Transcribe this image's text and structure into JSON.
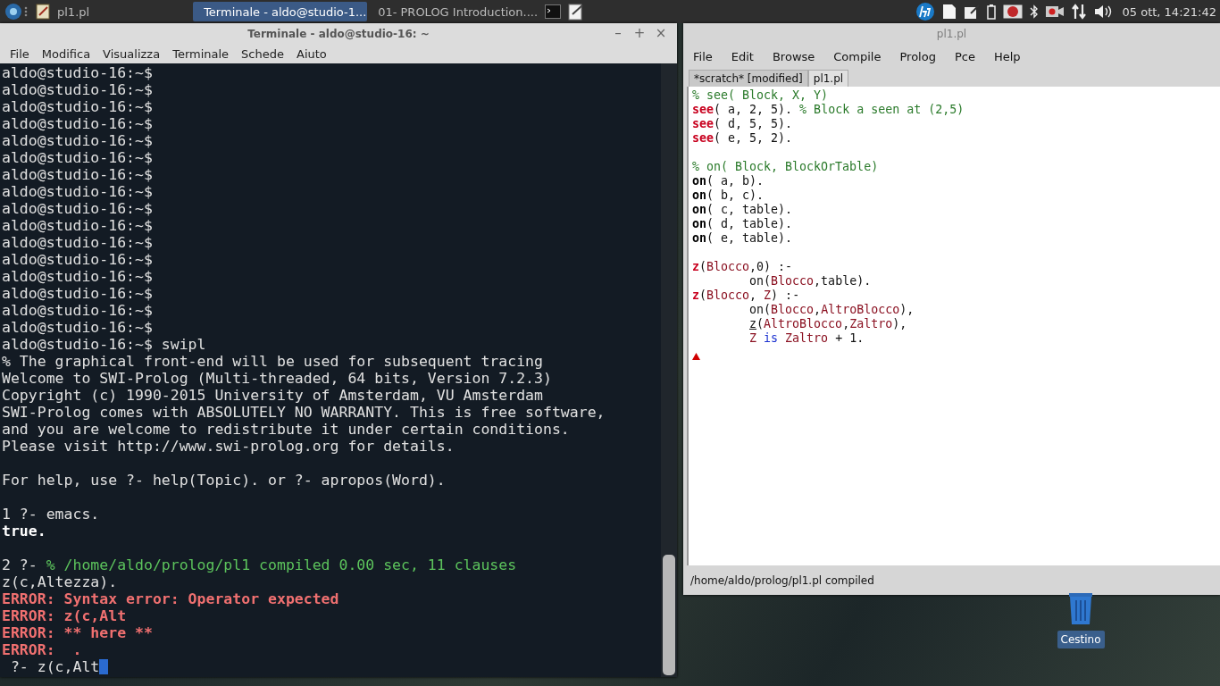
{
  "taskbar": {
    "tasks": [
      {
        "label": "pl1.pl",
        "kind": "editor",
        "selected": false
      },
      {
        "label": "Terminale - aldo@studio-1...",
        "kind": "terminal",
        "selected": true
      },
      {
        "label": "01- PROLOG Introduction....",
        "kind": "document",
        "selected": false
      }
    ],
    "clock": "05 ott, 14:21:42"
  },
  "terminal_window": {
    "title": "Terminale - aldo@studio-16: ~",
    "controls": [
      "–",
      "+",
      "×"
    ],
    "menu": [
      "File",
      "Modifica",
      "Visualizza",
      "Terminale",
      "Schede",
      "Aiuto"
    ],
    "lines": [
      {
        "kind": "text",
        "segments": [
          {
            "kind": "plain",
            "text": "aldo@studio-16:~$"
          }
        ]
      },
      {
        "kind": "text",
        "segments": [
          {
            "kind": "plain",
            "text": "aldo@studio-16:~$"
          }
        ]
      },
      {
        "kind": "text",
        "segments": [
          {
            "kind": "plain",
            "text": "aldo@studio-16:~$"
          }
        ]
      },
      {
        "kind": "text",
        "segments": [
          {
            "kind": "plain",
            "text": "aldo@studio-16:~$"
          }
        ]
      },
      {
        "kind": "text",
        "segments": [
          {
            "kind": "plain",
            "text": "aldo@studio-16:~$"
          }
        ]
      },
      {
        "kind": "text",
        "segments": [
          {
            "kind": "plain",
            "text": "aldo@studio-16:~$"
          }
        ]
      },
      {
        "kind": "text",
        "segments": [
          {
            "kind": "plain",
            "text": "aldo@studio-16:~$"
          }
        ]
      },
      {
        "kind": "text",
        "segments": [
          {
            "kind": "plain",
            "text": "aldo@studio-16:~$"
          }
        ]
      },
      {
        "kind": "text",
        "segments": [
          {
            "kind": "plain",
            "text": "aldo@studio-16:~$"
          }
        ]
      },
      {
        "kind": "text",
        "segments": [
          {
            "kind": "plain",
            "text": "aldo@studio-16:~$"
          }
        ]
      },
      {
        "kind": "text",
        "segments": [
          {
            "kind": "plain",
            "text": "aldo@studio-16:~$"
          }
        ]
      },
      {
        "kind": "text",
        "segments": [
          {
            "kind": "plain",
            "text": "aldo@studio-16:~$"
          }
        ]
      },
      {
        "kind": "text",
        "segments": [
          {
            "kind": "plain",
            "text": "aldo@studio-16:~$"
          }
        ]
      },
      {
        "kind": "text",
        "segments": [
          {
            "kind": "plain",
            "text": "aldo@studio-16:~$"
          }
        ]
      },
      {
        "kind": "text",
        "segments": [
          {
            "kind": "plain",
            "text": "aldo@studio-16:~$"
          }
        ]
      },
      {
        "kind": "text",
        "segments": [
          {
            "kind": "plain",
            "text": "aldo@studio-16:~$"
          }
        ]
      },
      {
        "kind": "text",
        "segments": [
          {
            "kind": "plain",
            "text": "aldo@studio-16:~$ swipl"
          }
        ]
      },
      {
        "kind": "text",
        "segments": [
          {
            "kind": "plain",
            "text": "% The graphical front-end will be used for subsequent tracing"
          }
        ]
      },
      {
        "kind": "text",
        "segments": [
          {
            "kind": "plain",
            "text": "Welcome to SWI-Prolog (Multi-threaded, 64 bits, Version 7.2.3)"
          }
        ]
      },
      {
        "kind": "text",
        "segments": [
          {
            "kind": "plain",
            "text": "Copyright (c) 1990-2015 University of Amsterdam, VU Amsterdam"
          }
        ]
      },
      {
        "kind": "text",
        "segments": [
          {
            "kind": "plain",
            "text": "SWI-Prolog comes with ABSOLUTELY NO WARRANTY. This is free software,"
          }
        ]
      },
      {
        "kind": "text",
        "segments": [
          {
            "kind": "plain",
            "text": "and you are welcome to redistribute it under certain conditions."
          }
        ]
      },
      {
        "kind": "text",
        "segments": [
          {
            "kind": "plain",
            "text": "Please visit http://www.swi-prolog.org for details."
          }
        ]
      },
      {
        "kind": "blank"
      },
      {
        "kind": "text",
        "segments": [
          {
            "kind": "plain",
            "text": "For help, use ?- help(Topic). or ?- apropos(Word)."
          }
        ]
      },
      {
        "kind": "blank"
      },
      {
        "kind": "text",
        "segments": [
          {
            "kind": "plain",
            "text": "1 ?- emacs."
          }
        ]
      },
      {
        "kind": "text",
        "segments": [
          {
            "kind": "bold",
            "text": "true."
          }
        ]
      },
      {
        "kind": "blank"
      },
      {
        "kind": "text",
        "segments": [
          {
            "kind": "plain",
            "text": "2 ?- "
          },
          {
            "kind": "comment",
            "text": "% /home/aldo/prolog/pl1 compiled 0.00 sec, 11 clauses"
          }
        ]
      },
      {
        "kind": "text",
        "segments": [
          {
            "kind": "plain",
            "text": "z(c,Altezza)."
          }
        ]
      },
      {
        "kind": "text",
        "segments": [
          {
            "kind": "error",
            "text": "ERROR: Syntax error: Operator expected"
          }
        ]
      },
      {
        "kind": "text",
        "segments": [
          {
            "kind": "error",
            "text": "ERROR: z(c,Alt"
          }
        ]
      },
      {
        "kind": "text",
        "segments": [
          {
            "kind": "error",
            "text": "ERROR: ** here **"
          }
        ]
      },
      {
        "kind": "text",
        "segments": [
          {
            "kind": "error",
            "text": "ERROR:  ."
          }
        ]
      },
      {
        "kind": "input",
        "segments": [
          {
            "kind": "plain",
            "text": " ?- z(c,Alt"
          }
        ]
      }
    ]
  },
  "editor_window": {
    "title": "pl1.pl",
    "menu": [
      "File",
      "Edit",
      "Browse",
      "Compile",
      "Prolog",
      "Pce",
      "Help"
    ],
    "tabs": [
      {
        "label": "*scratch* [modified]",
        "selected": false
      },
      {
        "label": "pl1.pl",
        "selected": true
      }
    ],
    "lines": [
      {
        "kind": "text",
        "segments": [
          {
            "kind": "comment",
            "text": "% see( Block, X, Y)"
          }
        ]
      },
      {
        "kind": "text",
        "segments": [
          {
            "kind": "head",
            "text": "see"
          },
          {
            "kind": "plain",
            "text": "( a, 2, 5). "
          },
          {
            "kind": "comment",
            "text": "% Block a seen at (2,5)"
          }
        ]
      },
      {
        "kind": "text",
        "segments": [
          {
            "kind": "head",
            "text": "see"
          },
          {
            "kind": "plain",
            "text": "( d, 5, 5)."
          }
        ]
      },
      {
        "kind": "text",
        "segments": [
          {
            "kind": "head",
            "text": "see"
          },
          {
            "kind": "plain",
            "text": "( e, 5, 2)."
          }
        ]
      },
      {
        "kind": "blank"
      },
      {
        "kind": "text",
        "segments": [
          {
            "kind": "comment",
            "text": "% on( Block, BlockOrTable)"
          }
        ]
      },
      {
        "kind": "text",
        "segments": [
          {
            "kind": "builtin",
            "text": "on"
          },
          {
            "kind": "plain",
            "text": "( a, b)."
          }
        ]
      },
      {
        "kind": "text",
        "segments": [
          {
            "kind": "builtin",
            "text": "on"
          },
          {
            "kind": "plain",
            "text": "( b, c)."
          }
        ]
      },
      {
        "kind": "text",
        "segments": [
          {
            "kind": "builtin",
            "text": "on"
          },
          {
            "kind": "plain",
            "text": "( c, table)."
          }
        ]
      },
      {
        "kind": "text",
        "segments": [
          {
            "kind": "builtin",
            "text": "on"
          },
          {
            "kind": "plain",
            "text": "( d, table)."
          }
        ]
      },
      {
        "kind": "text",
        "segments": [
          {
            "kind": "builtin",
            "text": "on"
          },
          {
            "kind": "plain",
            "text": "( e, table)."
          }
        ]
      },
      {
        "kind": "blank"
      },
      {
        "kind": "text",
        "segments": [
          {
            "kind": "head",
            "text": "z"
          },
          {
            "kind": "plain",
            "text": "("
          },
          {
            "kind": "var",
            "text": "Blocco"
          },
          {
            "kind": "plain",
            "text": ",0) :-"
          }
        ]
      },
      {
        "kind": "text",
        "segments": [
          {
            "kind": "plain",
            "text": "        on("
          },
          {
            "kind": "var",
            "text": "Blocco"
          },
          {
            "kind": "plain",
            "text": ",table)."
          }
        ]
      },
      {
        "kind": "text",
        "segments": [
          {
            "kind": "head",
            "text": "z"
          },
          {
            "kind": "plain",
            "text": "("
          },
          {
            "kind": "var",
            "text": "Blocco"
          },
          {
            "kind": "plain",
            "text": ", "
          },
          {
            "kind": "var",
            "text": "Z"
          },
          {
            "kind": "plain",
            "text": ") :-"
          }
        ]
      },
      {
        "kind": "text",
        "segments": [
          {
            "kind": "plain",
            "text": "        on("
          },
          {
            "kind": "var",
            "text": "Blocco"
          },
          {
            "kind": "plain",
            "text": ","
          },
          {
            "kind": "var",
            "text": "AltroBlocco"
          },
          {
            "kind": "plain",
            "text": "),"
          }
        ]
      },
      {
        "kind": "text",
        "indent": true,
        "segments": [
          {
            "kind": "goal",
            "text": "z"
          },
          {
            "kind": "plain",
            "text": "("
          },
          {
            "kind": "var",
            "text": "AltroBlocco"
          },
          {
            "kind": "plain",
            "text": ","
          },
          {
            "kind": "var",
            "text": "Zaltro"
          },
          {
            "kind": "plain",
            "text": "),"
          }
        ]
      },
      {
        "kind": "text",
        "indent": true,
        "segments": [
          {
            "kind": "var",
            "text": "Z"
          },
          {
            "kind": "keyword",
            "text": " is "
          },
          {
            "kind": "var",
            "text": "Zaltro"
          },
          {
            "kind": "plain",
            "text": " + 1."
          }
        ]
      }
    ],
    "status": "/home/aldo/prolog/pl1.pl compiled"
  },
  "desktop_icons": [
    {
      "label": "Cestino"
    }
  ]
}
